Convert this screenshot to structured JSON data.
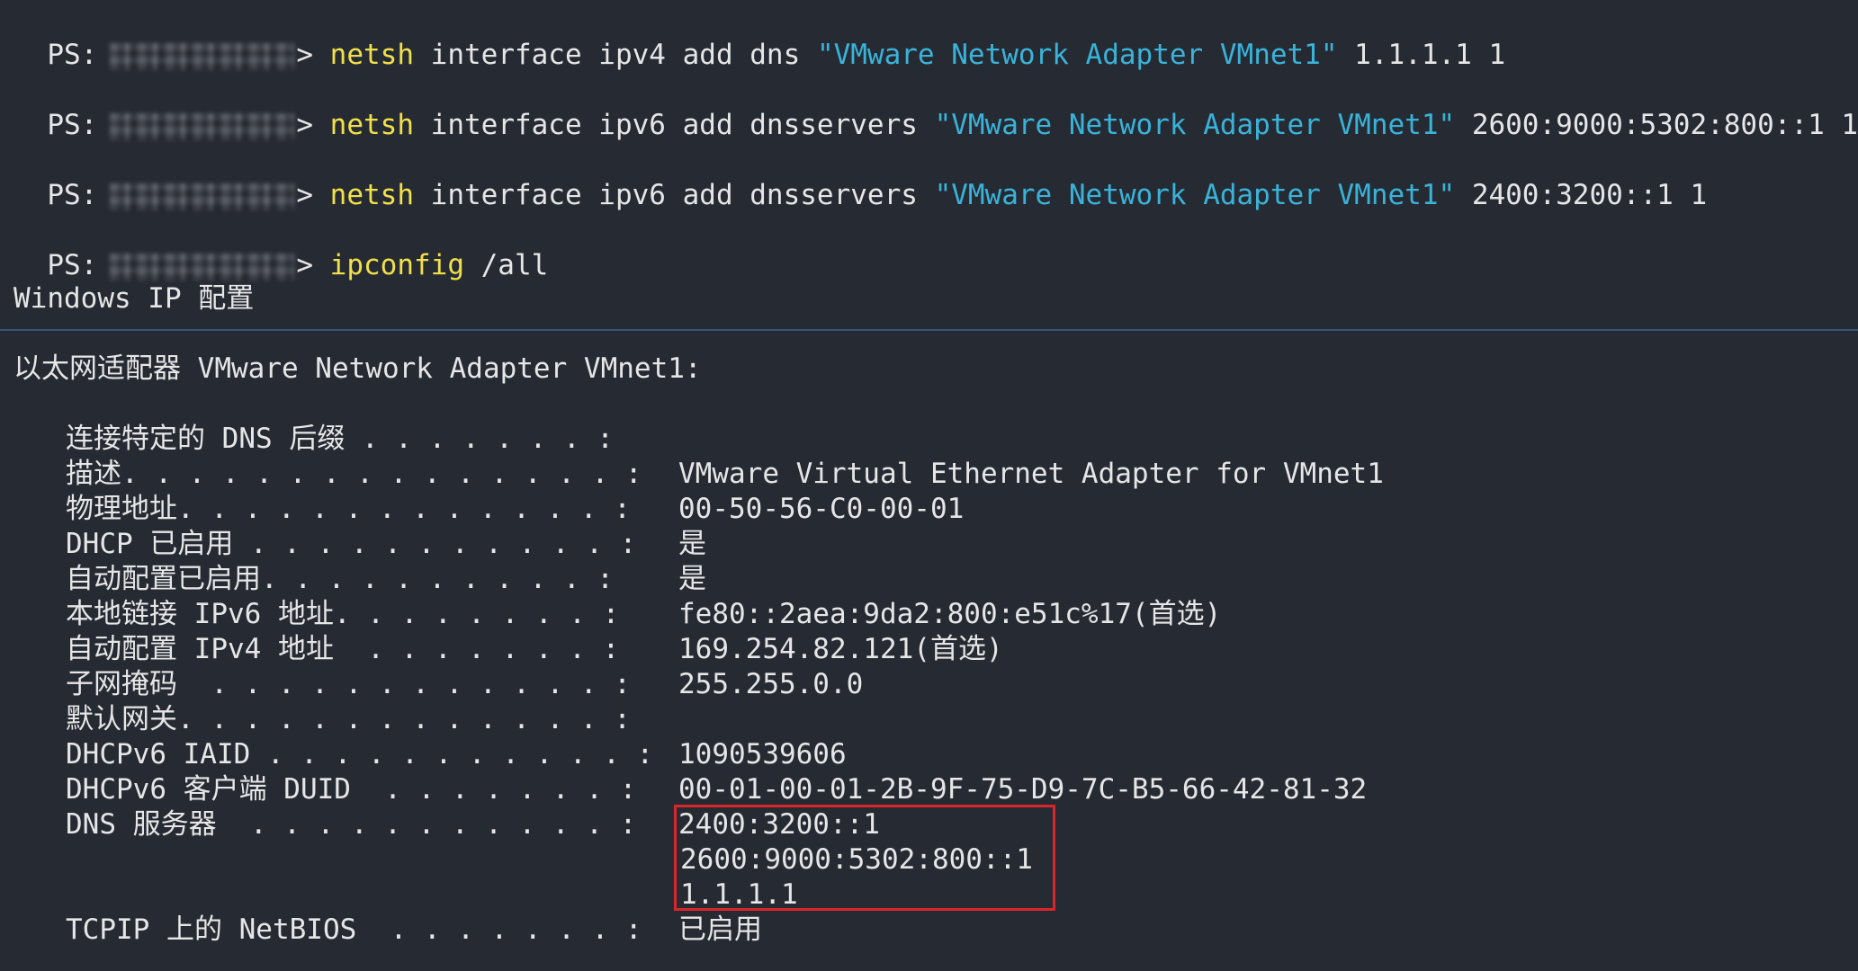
{
  "commands": [
    {
      "prompt": "PS:",
      "gt": ">",
      "cmd": "netsh",
      "args": " interface ipv4 add dns ",
      "str": "\"VMware Network Adapter VMnet1\"",
      "tail": " 1.1.1.1 1"
    },
    {
      "prompt": "PS:",
      "gt": ">",
      "cmd": "netsh",
      "args": " interface ipv6 add dnsservers ",
      "str": "\"VMware Network Adapter VMnet1\"",
      "tail": " 2600:9000:5302:800::1 1"
    },
    {
      "prompt": "PS:",
      "gt": ">",
      "cmd": "netsh",
      "args": " interface ipv6 add dnsservers ",
      "str": "\"VMware Network Adapter VMnet1\"",
      "tail": " 2400:3200::1 1"
    },
    {
      "prompt": "PS:",
      "gt": ">",
      "cmd": "ipconfig",
      "args": " /all",
      "str": "",
      "tail": ""
    }
  ],
  "ip_config_title": "Windows IP 配置",
  "adapter_title": "以太网适配器 VMware Network Adapter VMnet1:",
  "rows": [
    {
      "key": "连接特定的 DNS 后缀 . . . . . . . :",
      "value": ""
    },
    {
      "key": "描述. . . . . . . . . . . . . . . :",
      "value": "VMware Virtual Ethernet Adapter for VMnet1"
    },
    {
      "key": "物理地址. . . . . . . . . . . . . :",
      "value": "00-50-56-C0-00-01"
    },
    {
      "key": "DHCP 已启用 . . . . . . . . . . . :",
      "value": "是"
    },
    {
      "key": "自动配置已启用. . . . . . . . . . :",
      "value": "是"
    },
    {
      "key": "本地链接 IPv6 地址. . . . . . . . :",
      "value": "fe80::2aea:9da2:800:e51c%17(首选)"
    },
    {
      "key": "自动配置 IPv4 地址  . . . . . . . :",
      "value": "169.254.82.121(首选)"
    },
    {
      "key": "子网掩码  . . . . . . . . . . . . :",
      "value": "255.255.0.0"
    },
    {
      "key": "默认网关. . . . . . . . . . . . . :",
      "value": ""
    },
    {
      "key": "DHCPv6 IAID . . . . . . . . . . . :",
      "value": "1090539606"
    },
    {
      "key": "DHCPv6 客户端 DUID  . . . . . . . :",
      "value": "00-01-00-01-2B-9F-75-D9-7C-B5-66-42-81-32"
    },
    {
      "key": "DNS 服务器  . . . . . . . . . . . :",
      "value": "2400:3200::1"
    }
  ],
  "dns_extra": [
    "2600:9000:5302:800::1",
    "1.1.1.1"
  ],
  "netbios": {
    "key": "TCPIP 上的 NetBIOS  . . . . . . . :",
    "value": "已启用"
  },
  "colors": {
    "background": "#262a33",
    "command": "#f0e04a",
    "string": "#3ab3d9",
    "highlight_border": "#d9262b"
  }
}
